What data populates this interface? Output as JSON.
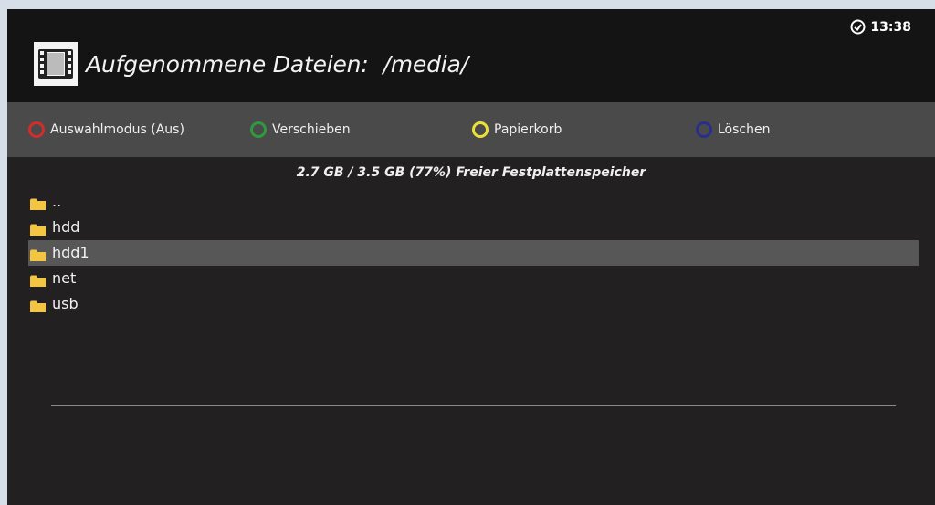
{
  "header": {
    "title": "Aufgenommene Dateien:",
    "path": "/media/",
    "clock": "13:38",
    "logo_icon": "film-icon"
  },
  "buttons": [
    {
      "label": "Auswahlmodus (Aus)",
      "color": "#d12d2d"
    },
    {
      "label": "Verschieben",
      "color": "#2e9a3e"
    },
    {
      "label": "Papierkorb",
      "color": "#ece034"
    },
    {
      "label": "Löschen",
      "color": "#26308c"
    }
  ],
  "disk_info": "2.7 GB / 3.5 GB (77%) Freier Festplattenspeicher",
  "folders": [
    {
      "label": "..",
      "selected": false
    },
    {
      "label": "hdd",
      "selected": false
    },
    {
      "label": "hdd1",
      "selected": true
    },
    {
      "label": "net",
      "selected": false
    },
    {
      "label": "usb",
      "selected": false
    }
  ],
  "colors": {
    "folder": "#f4c542",
    "selected_row": "#575757"
  }
}
